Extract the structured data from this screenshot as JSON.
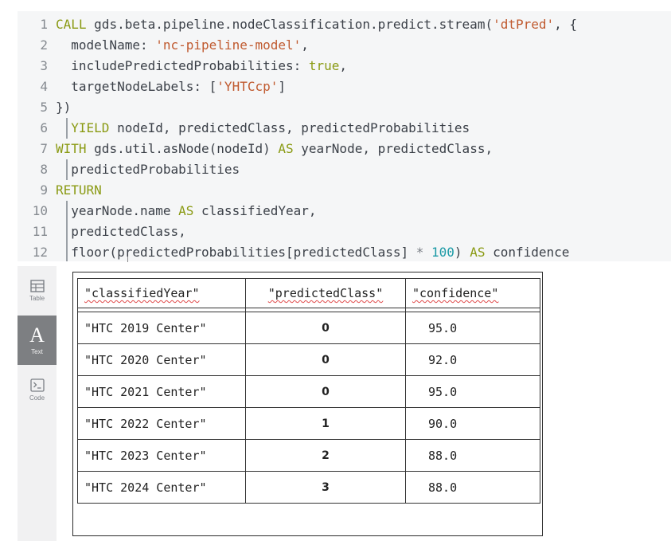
{
  "editor": {
    "lines": [
      {
        "n": "1",
        "parts": [
          [
            "kw",
            "CALL "
          ],
          [
            "",
            "gds.beta.pipeline.nodeClassification.predict.stream("
          ],
          [
            "str",
            "'dtPred'"
          ],
          [
            "",
            ", {"
          ]
        ]
      },
      {
        "n": "2",
        "parts": [
          [
            "",
            "  modelName: "
          ],
          [
            "str",
            "'nc-pipeline-model'"
          ],
          [
            "",
            ","
          ]
        ]
      },
      {
        "n": "3",
        "parts": [
          [
            "",
            "  includePredictedProbabilities: "
          ],
          [
            "kw",
            "true"
          ],
          [
            "",
            ","
          ]
        ]
      },
      {
        "n": "4",
        "parts": [
          [
            "",
            "  targetNodeLabels: ["
          ],
          [
            "str",
            "'YHTCcp'"
          ],
          [
            "",
            "]"
          ]
        ]
      },
      {
        "n": "5",
        "parts": [
          [
            "",
            "})"
          ]
        ]
      },
      {
        "n": "6",
        "parts": [
          [
            "",
            "  "
          ],
          [
            "kw",
            "YIELD "
          ],
          [
            "",
            "nodeId, predictedClass, predictedProbabilities"
          ]
        ]
      },
      {
        "n": "7",
        "parts": [
          [
            "kw",
            "WITH "
          ],
          [
            "",
            "gds.util.asNode(nodeId) "
          ],
          [
            "kw",
            "AS "
          ],
          [
            "",
            "yearNode, predictedClass,"
          ]
        ]
      },
      {
        "n": "8",
        "parts": [
          [
            "",
            "  predictedProbabilities"
          ]
        ]
      },
      {
        "n": "9",
        "parts": [
          [
            "kw",
            "RETURN"
          ]
        ]
      },
      {
        "n": "10",
        "parts": [
          [
            "",
            "  yearNode.name "
          ],
          [
            "kw",
            "AS "
          ],
          [
            "",
            "classifiedYear,"
          ]
        ]
      },
      {
        "n": "11",
        "parts": [
          [
            "",
            "  predictedClass,"
          ]
        ]
      },
      {
        "n": "12",
        "parts": [
          [
            "",
            "  floor(predictedProbabilities[predictedClass] "
          ],
          [
            "op",
            "* "
          ],
          [
            "num",
            "100"
          ],
          [
            "",
            ") "
          ],
          [
            "kw",
            "AS "
          ],
          [
            "",
            "confidence"
          ]
        ]
      }
    ]
  },
  "sidebar": {
    "table_label": "Table",
    "text_label": "Text",
    "code_label": "Code",
    "text_glyph": "A",
    "code_glyph": ">_",
    "active": "Text",
    "icons": {
      "table": "table-icon",
      "text": "text-icon",
      "code": "code-icon"
    }
  },
  "results": {
    "headers": [
      "\"classifiedYear\"",
      "\"predictedClass\"",
      "\"confidence\""
    ],
    "rows": [
      [
        "\"HTC 2019 Center\"",
        "0",
        "95.0"
      ],
      [
        "\"HTC 2020 Center\"",
        "0",
        "92.0"
      ],
      [
        "\"HTC 2021 Center\"",
        "0",
        "95.0"
      ],
      [
        "\"HTC 2022 Center\"",
        "1",
        "90.0"
      ],
      [
        "\"HTC 2023 Center\"",
        "2",
        "88.0"
      ],
      [
        "\"HTC 2024 Center\"",
        "3",
        "88.0"
      ]
    ]
  },
  "colors": {
    "keyword": "#8a9a13",
    "string": "#c05a2f",
    "number": "#1c9aa6",
    "editor_bg": "#f5f6f7",
    "active_tab": "#7d7f82"
  }
}
